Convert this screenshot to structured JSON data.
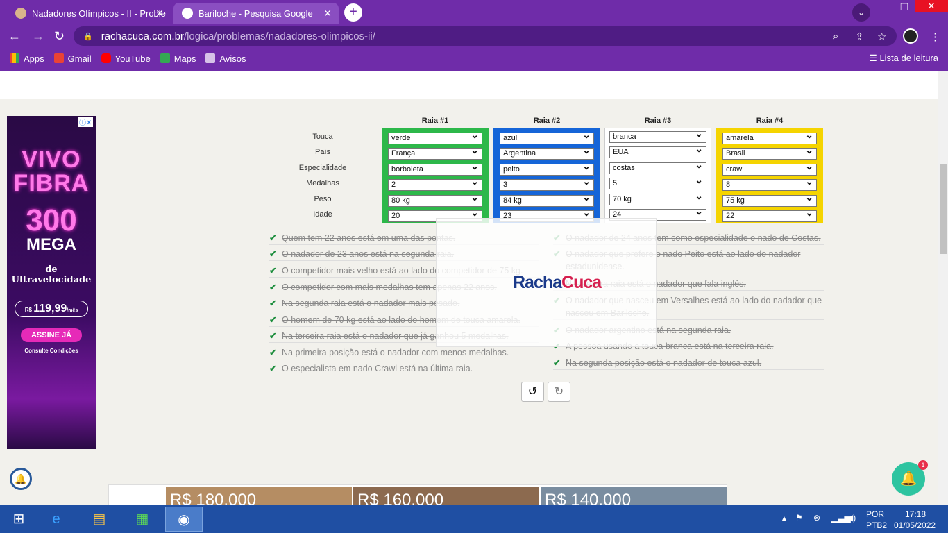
{
  "browser": {
    "tabs": [
      {
        "title": "Nadadores Olímpicos - II - Proble"
      },
      {
        "title": "Bariloche - Pesquisa Google"
      }
    ],
    "url_host": "rachacuca.com.br",
    "url_path": "/logica/problemas/nadadores-olimpicos-ii/",
    "bookmarks": [
      "Apps",
      "Gmail",
      "YouTube",
      "Maps",
      "Avisos"
    ],
    "reading_list": "Lista de leitura",
    "accent": "#6f2ca9"
  },
  "ad": {
    "line1": "VIVO",
    "line2": "FIBRA",
    "speed": "300",
    "unit": "MEGA",
    "de": "de",
    "ultra": "Ultravelocidade",
    "price": "119,99",
    "cta": "ASSINE JÁ",
    "cond": "Consulte Condições"
  },
  "puzzle": {
    "row_labels": [
      "Touca",
      "País",
      "Especialidade",
      "Medalhas",
      "Peso",
      "Idade"
    ],
    "lanes": [
      {
        "title": "Raia #1",
        "color": "#2db84a",
        "values": [
          "verde",
          "França",
          "borboleta",
          "2",
          "80 kg",
          "20"
        ]
      },
      {
        "title": "Raia #2",
        "color": "#1565d8",
        "values": [
          "azul",
          "Argentina",
          "peito",
          "3",
          "84 kg",
          "23"
        ]
      },
      {
        "title": "Raia #3",
        "color": "#ffffff",
        "values": [
          "branca",
          "EUA",
          "costas",
          "5",
          "70 kg",
          "24"
        ]
      },
      {
        "title": "Raia #4",
        "color": "#f5d400",
        "values": [
          "amarela",
          "Brasil",
          "crawl",
          "8",
          "75 kg",
          "22"
        ]
      }
    ],
    "clues_left": [
      "Quem tem 22 anos está em uma das pontas.",
      "O nadador de 23 anos está na segunda raia.",
      "O competidor mais velho está ao lado do competidor de 75 kg.",
      "O competidor com mais medalhas tem apenas 22 anos.",
      "Na segunda raia está o nadador mais pesado.",
      "O homem de 70 kg está ao lado do homem de touca amarela.",
      "Na terceira raia está o nadador que já ganhou 5 medalhas.",
      "Na primeira posição está o nadador com menos medalhas.",
      "O especialista em nado Crawl está na última raia."
    ],
    "clues_right": [
      "O nadador de 24 anos tem como especialidade o nado de Costas.",
      "O nadador que prefere o nado Peito está ao lado do nadador estadunidense.",
      "Na terceira raia está o nadador que fala inglês.",
      "O nadador que nasceu em Versalhes está ao lado do nadador que nasceu em Bariloche.",
      "O nadador argentino está na segunda raia.",
      "A pessoa usando a touca branca está na terceira raia.",
      "Na segunda posição está o nadador de touca azul."
    ],
    "logo_a": "Racha",
    "logo_b": "Cuca"
  },
  "bottom_ad": [
    "R$ 180.000",
    "R$ 160.000",
    "R$ 140.000"
  ],
  "chat_badge": "1",
  "system": {
    "lang": "POR",
    "layout": "PTB2",
    "time": "17:18",
    "date": "01/05/2022"
  }
}
